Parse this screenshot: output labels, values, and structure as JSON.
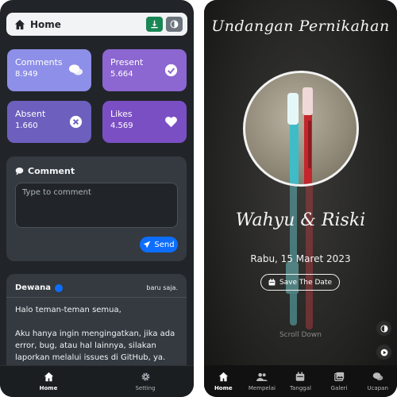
{
  "left": {
    "header": {
      "title": "Home"
    },
    "stats": [
      {
        "label": "Comments",
        "value": "8.949",
        "icon": "chat-icon"
      },
      {
        "label": "Present",
        "value": "5.664",
        "icon": "check-circle-icon"
      },
      {
        "label": "Absent",
        "value": "1.660",
        "icon": "x-circle-icon"
      },
      {
        "label": "Likes",
        "value": "4.569",
        "icon": "heart-icon"
      }
    ],
    "comment_form": {
      "title": "Comment",
      "placeholder": "Type to comment",
      "send_label": "Send"
    },
    "message": {
      "author": "Dewana",
      "time": "baru saja.",
      "greeting": "Halo teman-teman semua,",
      "body": "Aku hanya ingin mengingatkan, jika ada error, bug, atau hal lainnya, silakan laporkan melalui issues di GitHub, ya."
    },
    "nav": [
      {
        "label": "Home"
      },
      {
        "label": "Setting"
      }
    ]
  },
  "right": {
    "title": "Undangan Pernikahan",
    "names": "Wahyu & Riski",
    "date": "Rabu, 15 Maret 2023",
    "save_label": "Save The Date",
    "scroll_label": "Scroll Down",
    "nav": [
      {
        "label": "Home"
      },
      {
        "label": "Mempelai"
      },
      {
        "label": "Tanggal"
      },
      {
        "label": "Galeri"
      },
      {
        "label": "Ucapan"
      }
    ]
  },
  "colors": {
    "accent_blue": "#0d6efd",
    "green": "#198754",
    "card_dark": "#343a40"
  }
}
